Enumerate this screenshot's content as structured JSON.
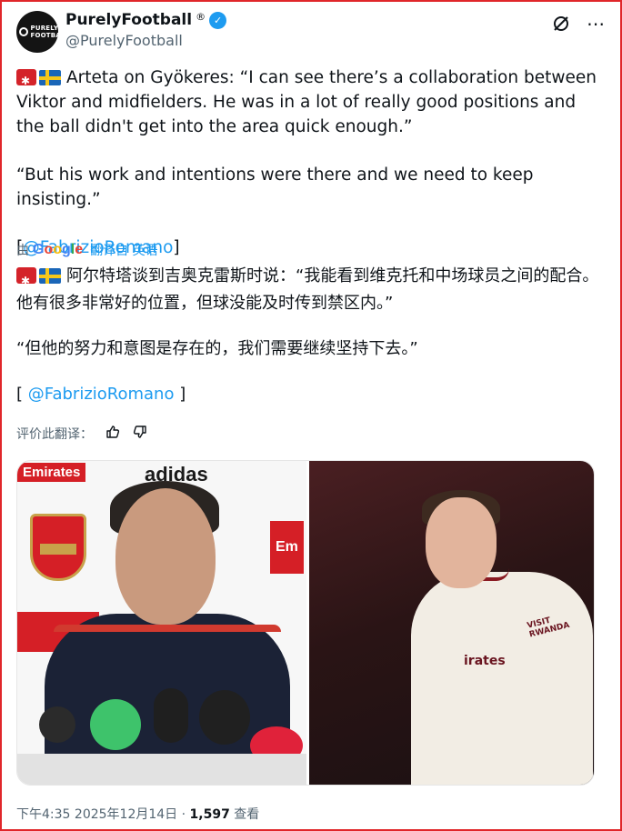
{
  "author": {
    "display_name": "PurelyFootball",
    "registered_mark": "®",
    "handle": "@PurelyFootball",
    "avatar_text": "PURELY FOOTBALL"
  },
  "post": {
    "en_para1": "Arteta on Gyökeres: “I can see there’s a collaboration between Viktor and midfielders. He was in a lot of really good positions and the ball didn't get into the area quick enough.”",
    "en_para2": "“But his work and intentions were there and we need to keep insisting.”",
    "en_mention_open": "[",
    "en_mention": "@FabrizioRomano",
    "en_mention_close": "]",
    "translated_by_prefix": "由",
    "translated_by_suffix": "翻译自 英语",
    "zh_para1": "阿尔特塔谈到吉奥克雷斯时说：“我能看到维克托和中场球员之间的配合。他有很多非常好的位置，但球没能及时传到禁区内。”",
    "zh_para2": "“但他的努力和意图是存在的，我们需要继续坚持下去。”",
    "zh_mention_open": "[",
    "zh_mention": "@FabrizioRomano",
    "zh_mention_close": "]",
    "rate_label": "评价此翻译："
  },
  "media": {
    "left_sign_1": "Emirates",
    "left_sign_2": "adidas",
    "left_sign_3": "Em",
    "right_shirt_text": "irates",
    "right_shirt_sponsor": "VISIT RWANDA"
  },
  "footer": {
    "time": "下午4:35",
    "date": "2025年12月14日",
    "separator": "·",
    "views": "1,597",
    "views_label": "查看"
  },
  "colors": {
    "accent": "#1d9bf0",
    "frame": "#e0262a",
    "text": "#0f1419",
    "muted": "#536471"
  }
}
